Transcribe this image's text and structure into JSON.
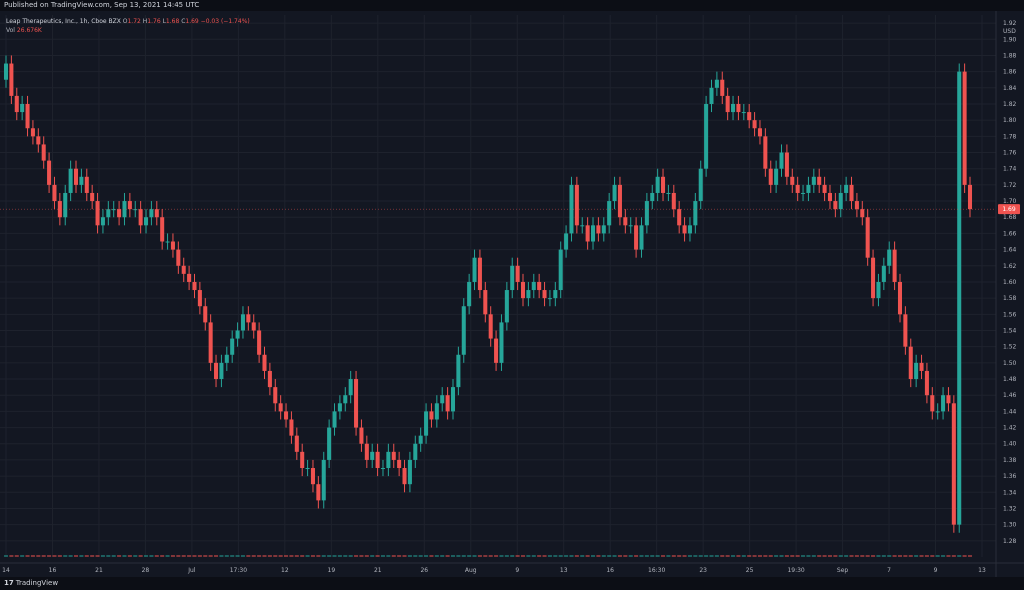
{
  "header": {
    "published": "Published on TradingView.com, Sep 13, 2021 14:45 UTC"
  },
  "legend": {
    "symbol": "Leap Therapeutics, Inc., 1h, Cboe BZX",
    "o_key": "O",
    "o_val": "1.72",
    "h_key": "H",
    "h_val": "1.76",
    "l_key": "L",
    "l_val": "1.68",
    "c_key": "C",
    "c_val": "1.69",
    "change": "−0.03 (−1.74%)",
    "vol_key": "Vol",
    "vol_val": "26.676K"
  },
  "price_axis": {
    "currency": "USD",
    "current_price": "1.69"
  },
  "footer": {
    "logo_mark": "17",
    "logo_text": "TradingView"
  },
  "colors": {
    "background": "#131722",
    "up": "#26a69a",
    "down": "#ef5350",
    "grid": "#1e222d",
    "text": "#b2b5be"
  },
  "chart_data": {
    "type": "candlestick",
    "title": "Leap Therapeutics, Inc., 1h, Cboe BZX",
    "ylim": [
      1.26,
      1.93
    ],
    "y_ticks": [
      "1.92",
      "1.90",
      "1.88",
      "1.86",
      "1.84",
      "1.82",
      "1.80",
      "1.78",
      "1.76",
      "1.74",
      "1.72",
      "1.70",
      "1.68",
      "1.66",
      "1.64",
      "1.62",
      "1.60",
      "1.58",
      "1.56",
      "1.54",
      "1.52",
      "1.50",
      "1.48",
      "1.46",
      "1.44",
      "1.42",
      "1.40",
      "1.38",
      "1.36",
      "1.34",
      "1.32",
      "1.30",
      "1.28"
    ],
    "x_ticks": [
      "14",
      "16",
      "21",
      "28",
      "Jul",
      "17:30",
      "12",
      "19",
      "21",
      "26",
      "Aug",
      "9",
      "13",
      "16",
      "16:30",
      "23",
      "25",
      "19:30",
      "Sep",
      "7",
      "9",
      "13"
    ],
    "grid": true,
    "current_price": 1.69,
    "series": [
      {
        "name": "price",
        "close": [
          1.87,
          1.83,
          1.81,
          1.82,
          1.79,
          1.78,
          1.77,
          1.75,
          1.72,
          1.7,
          1.68,
          1.71,
          1.74,
          1.72,
          1.73,
          1.71,
          1.7,
          1.67,
          1.68,
          1.69,
          1.69,
          1.68,
          1.7,
          1.69,
          1.69,
          1.67,
          1.68,
          1.69,
          1.68,
          1.65,
          1.65,
          1.64,
          1.62,
          1.61,
          1.6,
          1.59,
          1.57,
          1.55,
          1.5,
          1.48,
          1.5,
          1.51,
          1.53,
          1.54,
          1.56,
          1.55,
          1.54,
          1.51,
          1.49,
          1.47,
          1.45,
          1.44,
          1.43,
          1.41,
          1.39,
          1.37,
          1.37,
          1.35,
          1.33,
          1.38,
          1.42,
          1.44,
          1.45,
          1.46,
          1.48,
          1.42,
          1.4,
          1.38,
          1.39,
          1.37,
          1.37,
          1.39,
          1.38,
          1.37,
          1.35,
          1.38,
          1.4,
          1.41,
          1.44,
          1.43,
          1.45,
          1.46,
          1.44,
          1.47,
          1.51,
          1.57,
          1.6,
          1.63,
          1.59,
          1.56,
          1.53,
          1.5,
          1.55,
          1.59,
          1.62,
          1.6,
          1.58,
          1.59,
          1.6,
          1.59,
          1.58,
          1.58,
          1.59,
          1.64,
          1.66,
          1.72,
          1.67,
          1.67,
          1.65,
          1.67,
          1.66,
          1.67,
          1.7,
          1.72,
          1.68,
          1.67,
          1.67,
          1.64,
          1.67,
          1.7,
          1.71,
          1.73,
          1.71,
          1.71,
          1.69,
          1.67,
          1.66,
          1.67,
          1.7,
          1.74,
          1.82,
          1.84,
          1.85,
          1.83,
          1.81,
          1.82,
          1.81,
          1.81,
          1.8,
          1.79,
          1.78,
          1.74,
          1.72,
          1.74,
          1.76,
          1.73,
          1.72,
          1.71,
          1.71,
          1.72,
          1.73,
          1.72,
          1.71,
          1.7,
          1.69,
          1.71,
          1.72,
          1.7,
          1.69,
          1.68,
          1.63,
          1.58,
          1.6,
          1.62,
          1.64,
          1.6,
          1.56,
          1.52,
          1.48,
          1.5,
          1.49,
          1.46,
          1.44,
          1.44,
          1.46,
          1.45,
          1.3,
          1.86,
          1.72,
          1.69
        ],
        "open": [
          1.85,
          1.87,
          1.83,
          1.81,
          1.82,
          1.79,
          1.78,
          1.77,
          1.75,
          1.72,
          1.7,
          1.68,
          1.71,
          1.74,
          1.72,
          1.73,
          1.71,
          1.7,
          1.67,
          1.68,
          1.69,
          1.69,
          1.68,
          1.7,
          1.69,
          1.69,
          1.67,
          1.68,
          1.69,
          1.68,
          1.65,
          1.65,
          1.64,
          1.62,
          1.61,
          1.6,
          1.59,
          1.57,
          1.55,
          1.5,
          1.48,
          1.5,
          1.51,
          1.53,
          1.54,
          1.56,
          1.55,
          1.54,
          1.51,
          1.49,
          1.47,
          1.45,
          1.44,
          1.43,
          1.41,
          1.39,
          1.37,
          1.37,
          1.35,
          1.33,
          1.38,
          1.42,
          1.44,
          1.45,
          1.46,
          1.48,
          1.42,
          1.4,
          1.38,
          1.39,
          1.37,
          1.37,
          1.39,
          1.38,
          1.37,
          1.35,
          1.38,
          1.4,
          1.41,
          1.44,
          1.43,
          1.45,
          1.46,
          1.44,
          1.47,
          1.51,
          1.57,
          1.6,
          1.63,
          1.59,
          1.56,
          1.53,
          1.5,
          1.55,
          1.59,
          1.62,
          1.6,
          1.58,
          1.59,
          1.6,
          1.59,
          1.58,
          1.58,
          1.59,
          1.64,
          1.66,
          1.72,
          1.67,
          1.67,
          1.65,
          1.67,
          1.66,
          1.67,
          1.7,
          1.72,
          1.68,
          1.67,
          1.67,
          1.64,
          1.67,
          1.7,
          1.71,
          1.73,
          1.71,
          1.71,
          1.69,
          1.67,
          1.66,
          1.67,
          1.7,
          1.74,
          1.82,
          1.84,
          1.85,
          1.83,
          1.81,
          1.82,
          1.81,
          1.81,
          1.8,
          1.79,
          1.78,
          1.74,
          1.72,
          1.74,
          1.76,
          1.73,
          1.72,
          1.71,
          1.71,
          1.72,
          1.73,
          1.72,
          1.71,
          1.7,
          1.69,
          1.71,
          1.72,
          1.7,
          1.69,
          1.68,
          1.63,
          1.58,
          1.6,
          1.62,
          1.64,
          1.6,
          1.56,
          1.52,
          1.48,
          1.5,
          1.49,
          1.46,
          1.44,
          1.44,
          1.46,
          1.45,
          1.3,
          1.86,
          1.72
        ]
      }
    ]
  }
}
